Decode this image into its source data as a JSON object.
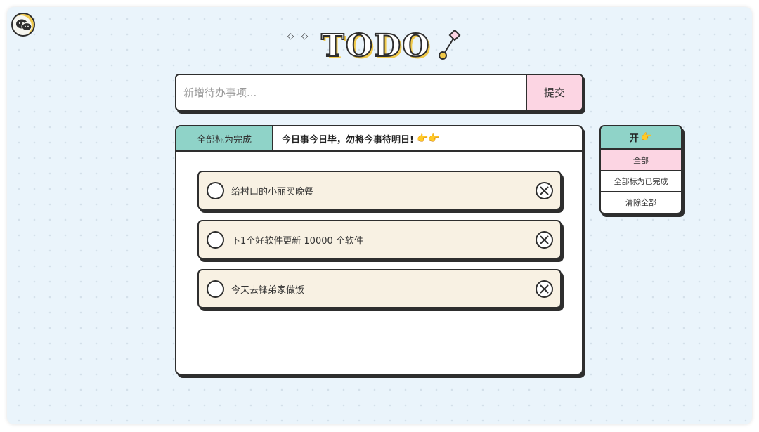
{
  "logo": {
    "text": "TODO",
    "diamond": "◇"
  },
  "input": {
    "placeholder": "新增待办事项...",
    "submit_label": "提交"
  },
  "toolbar": {
    "mark_all_label": "全部标为完成",
    "motto": "今日事今日毕，勿将今事待明日!",
    "motto_emoji": "👉👉"
  },
  "todos": [
    {
      "text": "给村口的小丽买晚餐"
    },
    {
      "text": "下1个好软件更新 10000 个软件"
    },
    {
      "text": "今天去锋弟家做饭"
    }
  ],
  "filter_panel": {
    "title": "开",
    "title_emoji": "👉",
    "items": [
      {
        "label": "全部"
      },
      {
        "label": "全部标为已完成"
      },
      {
        "label": "清除全部"
      }
    ]
  },
  "colors": {
    "teal": "#8fd3c8",
    "pink": "#fcd5e3",
    "cream": "#f8f1e3",
    "yellow": "#f0c94a",
    "ink": "#2e2e2e"
  }
}
